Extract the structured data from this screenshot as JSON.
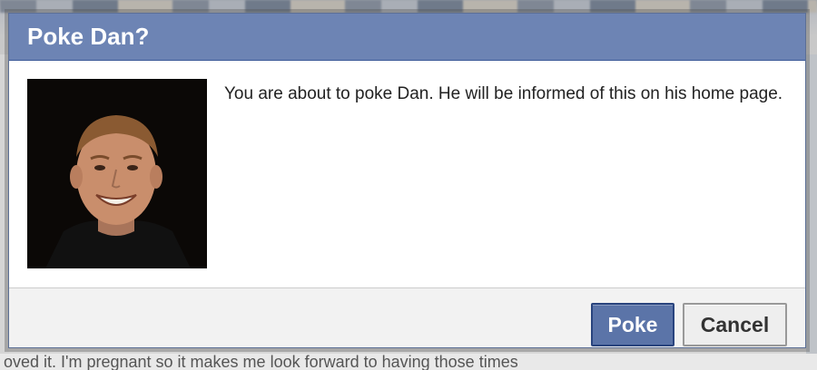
{
  "dialog": {
    "title": "Poke Dan?",
    "message": "You are about to poke Dan. He will be informed of this on his home page.",
    "avatar_alt": "profile photo of Dan",
    "buttons": {
      "confirm_label": "Poke",
      "cancel_label": "Cancel"
    }
  },
  "background": {
    "footer_text": "oved it. I'm pregnant so it makes me look forward to having those times"
  },
  "colors": {
    "header_blue": "#6d84b4",
    "header_border": "#3b5998",
    "confirm_button": "#5b74a8",
    "cancel_button": "#eeeeee",
    "footer_bg": "#f2f2f2"
  }
}
